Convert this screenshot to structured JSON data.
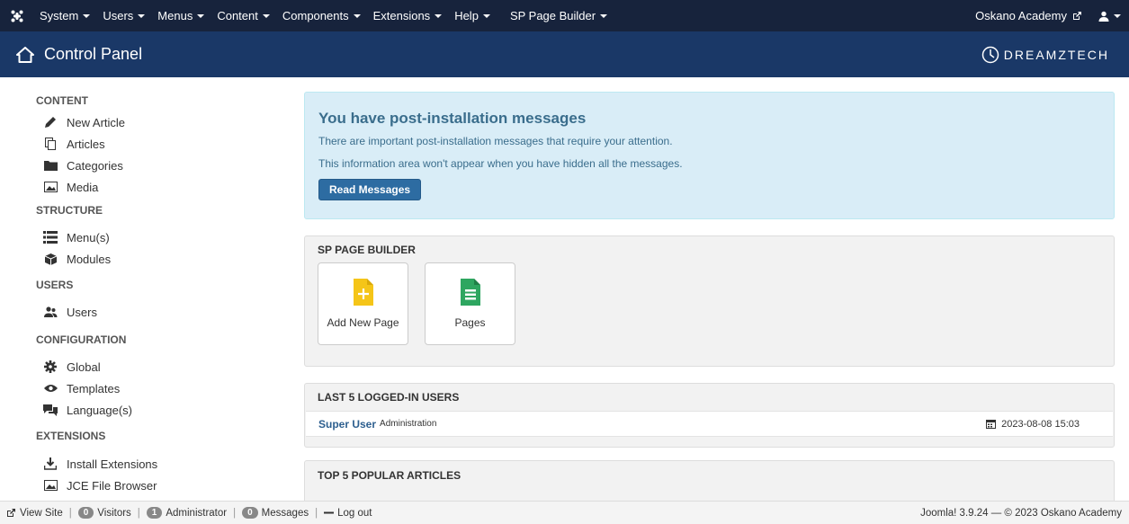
{
  "topbar": {
    "logo_icon": "joomla-icon",
    "menus": [
      "System",
      "Users",
      "Menus",
      "Content",
      "Components",
      "Extensions",
      "Help",
      "SP Page Builder"
    ],
    "site_link": "Oskano Academy",
    "site_link_icon": "external-link-icon",
    "user_icon": "user-icon"
  },
  "header": {
    "title": "Control Panel",
    "icon": "home-icon",
    "brand": "DREAMZTECH"
  },
  "sidebar": {
    "content_heading": "CONTENT",
    "content_items": [
      "New Article",
      "Articles",
      "Categories",
      "Media"
    ],
    "structure_heading": "STRUCTURE",
    "structure_items": [
      "Menu(s)",
      "Modules"
    ],
    "users_heading": "USERS",
    "users_items": [
      "Users"
    ],
    "configuration_heading": "CONFIGURATION",
    "configuration_items": [
      "Global",
      "Templates",
      "Language(s)"
    ],
    "extensions_heading": "EXTENSIONS",
    "extensions_items": [
      "Install Extensions",
      "JCE File Browser"
    ]
  },
  "alert": {
    "title": "You have post-installation messages",
    "line1": "There are important post-installation messages that require your attention.",
    "line2": "This information area won't appear when you have hidden all the messages.",
    "button": "Read Messages"
  },
  "spb": {
    "heading": "SP PAGE BUILDER",
    "tiles": [
      "Add New Page",
      "Pages"
    ]
  },
  "logged_users": {
    "heading": "LAST 5 LOGGED-IN USERS",
    "rows": [
      {
        "name": "Super User",
        "role": "Administration",
        "date": "2023-08-08 15:03"
      }
    ]
  },
  "popular": {
    "heading": "TOP 5 POPULAR ARTICLES"
  },
  "statusbar": {
    "view_site": "View Site",
    "visitors_count": "0",
    "visitors": "Visitors",
    "admin_count": "1",
    "admin": "Administrator",
    "messages_count": "0",
    "messages": "Messages",
    "logout": "Log out",
    "footer": "Joomla! 3.9.24 — © 2023 Oskano Academy"
  },
  "colors": {
    "topbar_bg": "#17233c",
    "header_bg": "#1a3867",
    "alert_bg": "#d9edf7",
    "primary_button": "#2d6ca2",
    "tile_add": "#f5c518",
    "tile_pages": "#2ea660"
  }
}
